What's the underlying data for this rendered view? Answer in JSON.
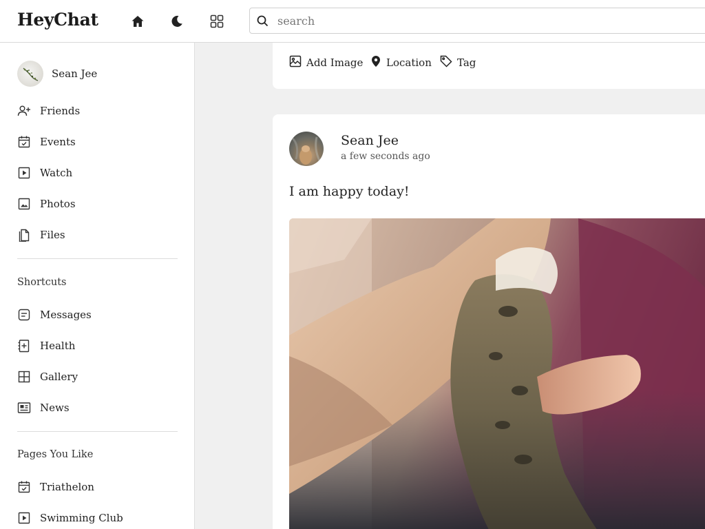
{
  "app": {
    "title": "HeyChat"
  },
  "topbar": {
    "icons": [
      "home-icon",
      "moon-icon",
      "grid-icon"
    ],
    "search": {
      "placeholder": "search",
      "value": ""
    }
  },
  "sidebar": {
    "user": {
      "name": "Sean Jee"
    },
    "items": [
      {
        "label": "Friends",
        "icon": "add-user-icon"
      },
      {
        "label": "Events",
        "icon": "calendar-check-icon"
      },
      {
        "label": "Watch",
        "icon": "play-icon"
      },
      {
        "label": "Photos",
        "icon": "image-icon"
      },
      {
        "label": "Files",
        "icon": "files-icon"
      }
    ],
    "shortcuts_title": "Shortcuts",
    "shortcuts": [
      {
        "label": "Messages",
        "icon": "message-icon"
      },
      {
        "label": "Health",
        "icon": "health-icon"
      },
      {
        "label": "Gallery",
        "icon": "gallery-icon"
      },
      {
        "label": "News",
        "icon": "news-icon"
      }
    ],
    "pages_title": "Pages You Like",
    "pages": [
      {
        "label": "Triathelon",
        "icon": "calendar-check-icon"
      },
      {
        "label": "Swimming Club",
        "icon": "play-icon"
      }
    ]
  },
  "composer": {
    "actions": [
      {
        "label": "Add Image",
        "icon": "image-icon"
      },
      {
        "label": "Location",
        "icon": "location-pin-icon"
      },
      {
        "label": "Tag",
        "icon": "tag-icon"
      }
    ]
  },
  "post": {
    "author": "Sean Jee",
    "time": "a few seconds ago",
    "text": "I am happy today!"
  },
  "colors": {
    "text": "#222222",
    "background": "#f0f0f0",
    "card": "#ffffff"
  }
}
